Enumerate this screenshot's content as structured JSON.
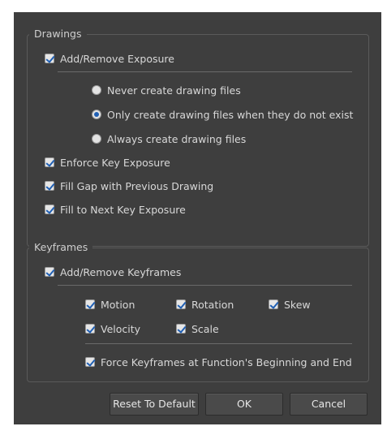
{
  "drawings": {
    "title": "Drawings",
    "add_remove_exposure": {
      "label": "Add/Remove Exposure",
      "checked": true
    },
    "radio_options": [
      {
        "label": "Never create drawing files",
        "selected": false
      },
      {
        "label": "Only create drawing files when they do not exist",
        "selected": true
      },
      {
        "label": "Always create drawing files",
        "selected": false
      }
    ],
    "enforce_key_exposure": {
      "label": "Enforce Key Exposure",
      "checked": true
    },
    "fill_gap": {
      "label": "Fill Gap with Previous Drawing",
      "checked": true
    },
    "fill_next_key": {
      "label": "Fill to Next Key Exposure",
      "checked": true
    }
  },
  "keyframes": {
    "title": "Keyframes",
    "add_remove_keyframes": {
      "label": "Add/Remove Keyframes",
      "checked": true
    },
    "options": {
      "motion": {
        "label": "Motion",
        "checked": true
      },
      "rotation": {
        "label": "Rotation",
        "checked": true
      },
      "skew": {
        "label": "Skew",
        "checked": true
      },
      "velocity": {
        "label": "Velocity",
        "checked": true
      },
      "scale": {
        "label": "Scale",
        "checked": true
      }
    },
    "force_keyframes": {
      "label": "Force Keyframes at Function's Beginning and End",
      "checked": true
    }
  },
  "buttons": {
    "reset": "Reset To Default",
    "ok": "OK",
    "cancel": "Cancel"
  },
  "colors": {
    "dialog_bg": "#3e3e3e",
    "accent_check": "#1f5fb4"
  }
}
